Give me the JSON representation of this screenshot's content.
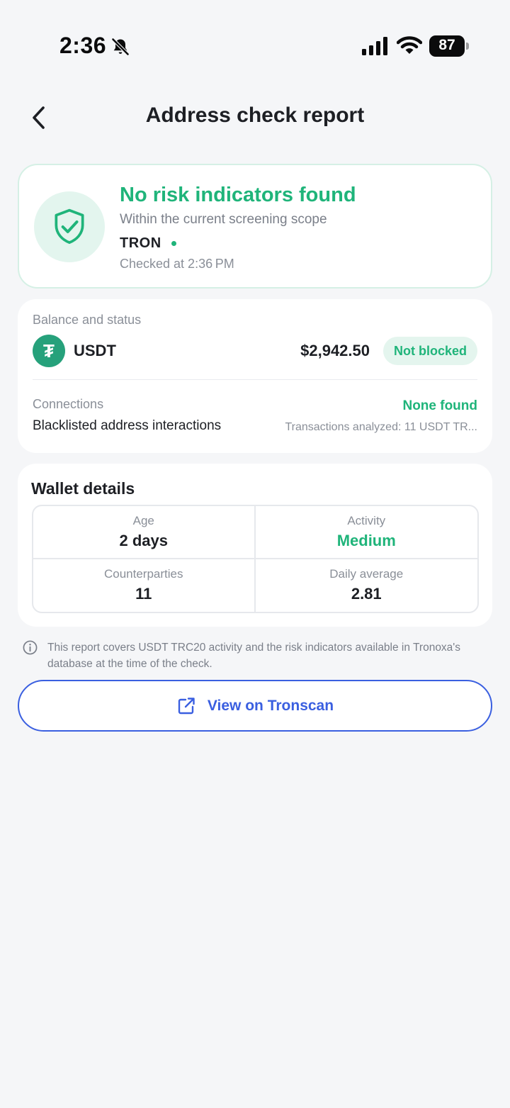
{
  "status_bar": {
    "time": "2:36",
    "battery": "87"
  },
  "header": {
    "title": "Address check report"
  },
  "result": {
    "title": "No risk indicators found",
    "subtitle": "Within the current screening scope",
    "network": "TRON",
    "checked": "Checked at 2:36 PM"
  },
  "balance": {
    "section_label": "Balance and status",
    "token": "USDT",
    "token_glyph": "₮",
    "amount": "$2,942.50",
    "status": "Not blocked",
    "connections_label": "Connections",
    "connections_text": "Blacklisted address interactions",
    "connections_status": "None found",
    "connections_note": "Transactions analyzed: 11 USDT TR..."
  },
  "wallet": {
    "title": "Wallet details",
    "stats": [
      {
        "label": "Age",
        "value": "2 days"
      },
      {
        "label": "Activity",
        "value": "Medium"
      },
      {
        "label": "Counterparties",
        "value": "11"
      },
      {
        "label": "Daily average",
        "value": "2.81"
      }
    ]
  },
  "disclaimer": "This report covers USDT TRC20 activity and the risk indicators available in Tronoxa's database at the time of the check.",
  "link_button": {
    "label": "View on Tronscan"
  },
  "colors": {
    "success": "#1fb47a",
    "link": "#3a5fe0",
    "tether": "#26a17b"
  },
  "icons": [
    "back-arrow-icon",
    "bell-muted-icon",
    "signal-icon",
    "wifi-icon",
    "shield-check-icon",
    "info-icon",
    "external-link-icon"
  ]
}
